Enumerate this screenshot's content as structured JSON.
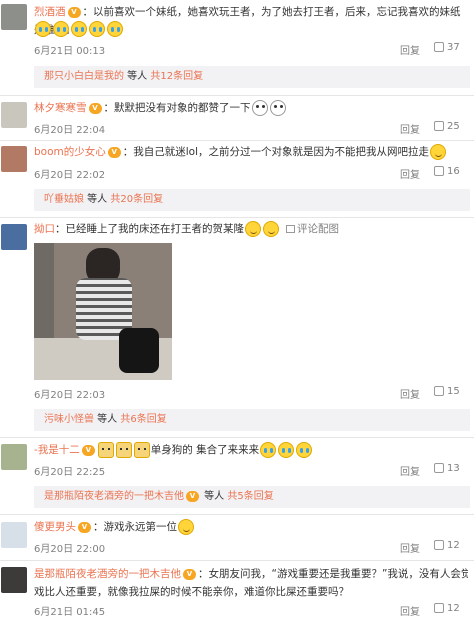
{
  "comments": [
    {
      "name": "烈酒酒",
      "text": "：以前喜欢一个妹纸，她喜欢玩王者，为了她去打王者，后来，忘记我喜欢的妹纸是谁了。",
      "time": "6月21日 00:13",
      "reply": "回复",
      "likes": "37"
    },
    {
      "name": "林夕寒寒雪",
      "text": "：默默把没有对象的都赞了一下",
      "time": "6月20日 22:04",
      "reply": "回复",
      "likes": "25"
    },
    {
      "name": "boom的少女心",
      "text": "：我自己就迷lol，之前分过一个对象就是因为不能把我从网吧拉走",
      "time": "6月20日 22:02",
      "reply": "回复",
      "likes": "16"
    },
    {
      "name": "拗口",
      "text": "：已经睡上了我的床还在打王者的贺某隆",
      "link": "评论配图",
      "time": "6月20日 22:03",
      "reply": "回复",
      "likes": "15"
    },
    {
      "name": "-我是十二",
      "text": "单身狗的  集合了来来来",
      "time": "6月20日 22:25",
      "reply": "回复",
      "likes": "13"
    },
    {
      "name": "傻更男头",
      "text": "：游戏永远第一位",
      "time": "6月20日 22:00",
      "reply": "回复",
      "likes": "12"
    },
    {
      "name": "是那瓶陌夜老酒旁的一把木吉他",
      "text": "：女朋友问我，“游戏重要还是我重要？”我说，没有人会觉得游戏比人还重要，就像我拉屎的时候不能亲你，难道你比屎还重要吗？",
      "text2": "戏比人还重要，就像我拉屎的时候不能亲你，难道你比屎还重要吗？",
      "text1": "：女朋友问我，“游戏重要还是我重要？”我说，没有人会觉得游",
      "time": "6月21日 01:45",
      "reply": "回复",
      "likes": "12"
    }
  ],
  "subs": [
    {
      "who": "那只小白白是我的",
      "mid": " 等人 ",
      "count": "共12条回复"
    },
    {
      "who": "吖垂姑娘",
      "mid": " 等人 ",
      "count": "共20条回复"
    },
    {
      "who": "污味小怪兽",
      "mid": " 等人 ",
      "count": "共6条回复"
    },
    {
      "who": "是那瓶陌夜老酒旁的一把木吉他",
      "mid": " 等人 ",
      "count": "共5条回复"
    }
  ],
  "vip_badge": "V",
  "colors": {
    "name": "#eb7350",
    "meta": "#808080",
    "sub_bg": "#f2f2f5"
  }
}
